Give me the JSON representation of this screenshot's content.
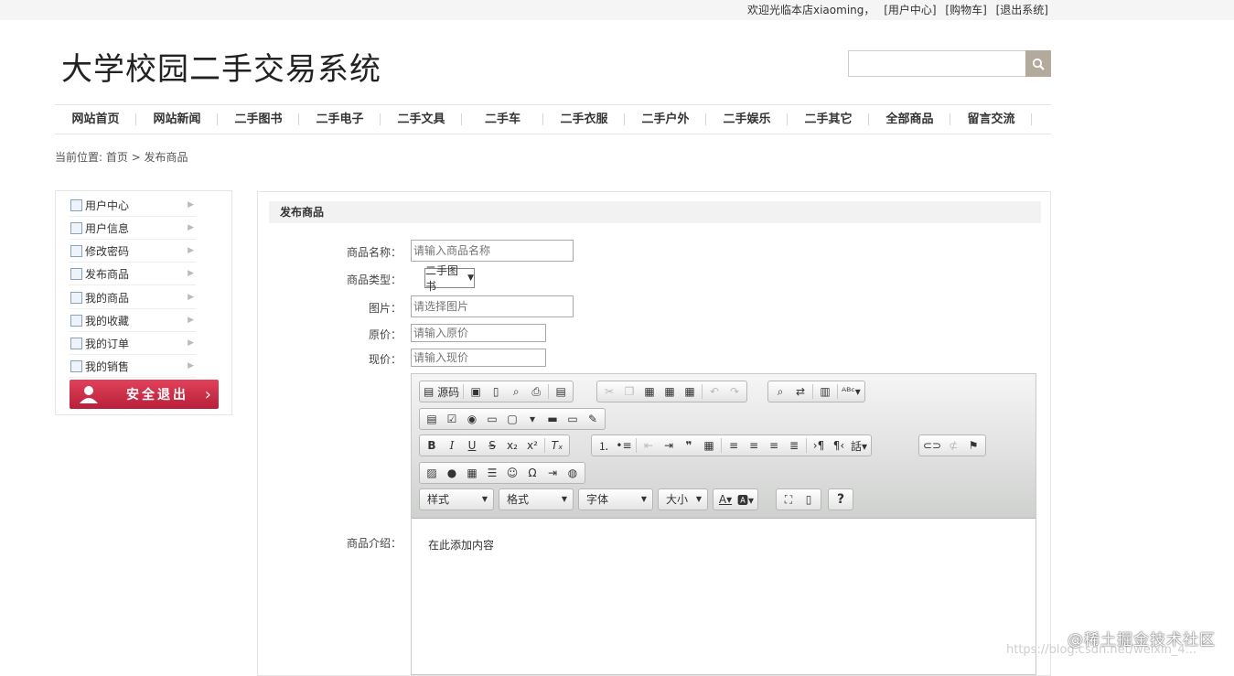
{
  "topbar": {
    "welcome": "欢迎光临本店xiaoming，",
    "user_center": "[用户中心]",
    "cart": "[购物车]",
    "logout": "[退出系统]"
  },
  "site": {
    "title": "大学校园二手交易系统"
  },
  "search": {
    "placeholder": ""
  },
  "nav": [
    "网站首页",
    "网站新闻",
    "二手图书",
    "二手电子",
    "二手文具",
    "二手车",
    "二手衣服",
    "二手户外",
    "二手娱乐",
    "二手其它",
    "全部商品",
    "留言交流"
  ],
  "breadcrumb": {
    "text": "当前位置: 首页 > 发布商品"
  },
  "sidebar": {
    "items": [
      "用户中心",
      "用户信息",
      "修改密码",
      "发布商品",
      "我的商品",
      "我的收藏",
      "我的订单",
      "我的销售"
    ],
    "logout_label": "安全退出"
  },
  "form": {
    "heading": "发布商品",
    "name_label": "商品名称：",
    "name_placeholder": "请输入商品名称",
    "type_label": "商品类型：",
    "type_value": "二手图书",
    "image_label": "图片：",
    "image_placeholder": "请选择图片",
    "orig_price_label": "原价：",
    "orig_price_placeholder": "请输入原价",
    "cur_price_label": "现价：",
    "cur_price_placeholder": "请输入现价",
    "desc_label": "商品介绍："
  },
  "editor": {
    "source_label": "源码",
    "combos": [
      "样式",
      "格式",
      "字体",
      "大小"
    ],
    "body_text": "在此添加内容"
  },
  "watermark": {
    "brand": "@稀土掘金技术社区",
    "url": "https://blog.csdn.net/weixin_4..."
  }
}
